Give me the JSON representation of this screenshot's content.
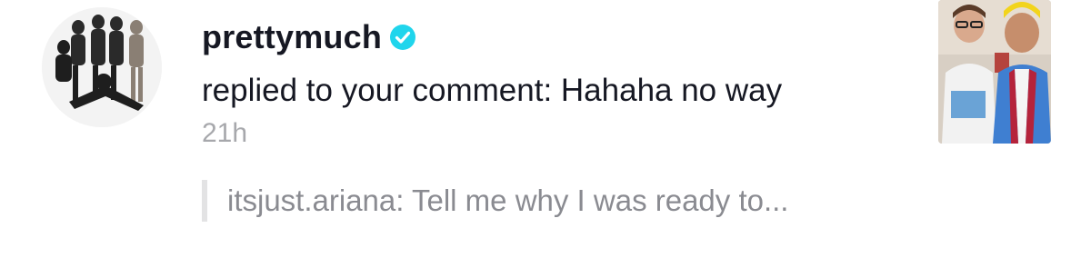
{
  "notification": {
    "username": "prettymuch",
    "verified": true,
    "action_text": "replied to your comment: Hahaha no way",
    "timestamp": "21h",
    "quoted_comment": "itsjust.ariana: Tell me why I was ready to..."
  },
  "icons": {
    "verified": "verified-badge-icon",
    "avatar": "profile-avatar",
    "thumbnail": "video-thumbnail"
  },
  "colors": {
    "text_primary": "#161823",
    "text_secondary": "#a7a8ac",
    "quote_text": "#8a8b91",
    "verified_badge": "#20d5ec",
    "quote_bar": "#e3e3e4"
  }
}
